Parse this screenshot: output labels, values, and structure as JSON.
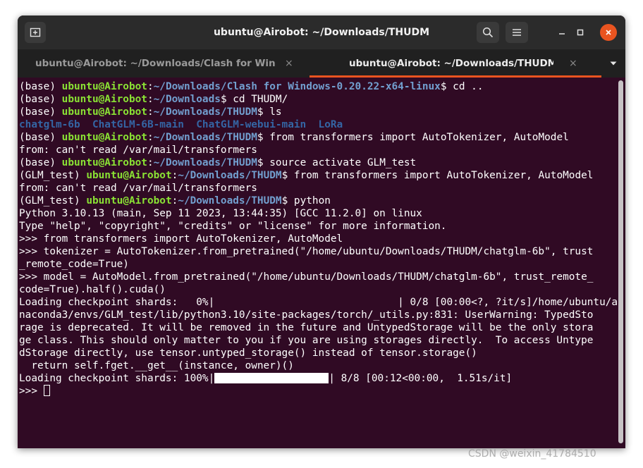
{
  "window": {
    "title": "ubuntu@Airobot: ~/Downloads/THUDM"
  },
  "tabs": [
    {
      "label": "ubuntu@Airobot: ~/Downloads/Clash for Win...",
      "active": false
    },
    {
      "label": "ubuntu@Airobot: ~/Downloads/THUDM",
      "active": true
    }
  ],
  "icons": {
    "new_tab": "new-tab-icon",
    "search": "search-icon",
    "menu": "hamburger-menu-icon",
    "minimize": "minimize-icon",
    "maximize": "maximize-icon",
    "close": "close-icon",
    "tab_close": "×",
    "tabs_dropdown": "chevron-down-icon"
  },
  "colors": {
    "terminal_bg": "#300a24",
    "user_host": "#8ae234",
    "path": "#729fcf",
    "directory": "#3465a4",
    "accent": "#e95420"
  },
  "terminal": {
    "lines": [
      {
        "type": "prompt",
        "env": "(base) ",
        "user": "ubuntu@Airobot",
        "path": "~/Downloads/Clash for Windows-0.20.22-x64-linux",
        "cmd": " cd .."
      },
      {
        "type": "prompt",
        "env": "(base) ",
        "user": "ubuntu@Airobot",
        "path": "~/Downloads",
        "cmd": " cd THUDM/"
      },
      {
        "type": "prompt",
        "env": "(base) ",
        "user": "ubuntu@Airobot",
        "path": "~/Downloads/THUDM",
        "cmd": " ls"
      },
      {
        "type": "dirs",
        "text": "chatglm-6b  ChatGLM-6B-main  ChatGLM-webui-main  LoRa"
      },
      {
        "type": "prompt",
        "env": "(base) ",
        "user": "ubuntu@Airobot",
        "path": "~/Downloads/THUDM",
        "cmd": " from transformers import AutoTokenizer, AutoModel"
      },
      {
        "type": "text",
        "text": "from: can't read /var/mail/transformers"
      },
      {
        "type": "prompt",
        "env": "(base) ",
        "user": "ubuntu@Airobot",
        "path": "~/Downloads/THUDM",
        "cmd": " source activate GLM_test"
      },
      {
        "type": "prompt",
        "env": "(GLM_test) ",
        "user": "ubuntu@Airobot",
        "path": "~/Downloads/THUDM",
        "cmd": " from transformers import AutoTokenizer, AutoModel"
      },
      {
        "type": "text",
        "text": "from: can't read /var/mail/transformers"
      },
      {
        "type": "prompt",
        "env": "(GLM_test) ",
        "user": "ubuntu@Airobot",
        "path": "~/Downloads/THUDM",
        "cmd": " python"
      },
      {
        "type": "text",
        "text": "Python 3.10.13 (main, Sep 11 2023, 13:44:35) [GCC 11.2.0] on linux"
      },
      {
        "type": "text",
        "text": "Type \"help\", \"copyright\", \"credits\" or \"license\" for more information."
      },
      {
        "type": "text",
        "text": ">>> from transformers import AutoTokenizer, AutoModel"
      },
      {
        "type": "text",
        "text": ">>> tokenizer = AutoTokenizer.from_pretrained(\"/home/ubuntu/Downloads/THUDM/chatglm-6b\", trust"
      },
      {
        "type": "text",
        "text": "_remote_code=True)"
      },
      {
        "type": "text",
        "text": ">>> model = AutoModel.from_pretrained(\"/home/ubuntu/Downloads/THUDM/chatglm-6b\", trust_remote_"
      },
      {
        "type": "text",
        "text": "code=True).half().cuda()"
      },
      {
        "type": "text",
        "text": "Loading checkpoint shards:   0%|                              | 0/8 [00:00<?, ?it/s]/home/ubuntu/a"
      },
      {
        "type": "text",
        "text": "naconda3/envs/GLM_test/lib/python3.10/site-packages/torch/_utils.py:831: UserWarning: TypedSto"
      },
      {
        "type": "text",
        "text": "rage is deprecated. It will be removed in the future and UntypedStorage will be the only stora"
      },
      {
        "type": "text",
        "text": "ge class. This should only matter to you if you are using storages directly.  To access Untype"
      },
      {
        "type": "text",
        "text": "dStorage directly, use tensor.untyped_storage() instead of tensor.storage()"
      },
      {
        "type": "text",
        "text": "  return self.fget.__get__(instance, owner)()"
      },
      {
        "type": "progress",
        "pre": "Loading checkpoint shards: 100%|",
        "progress": 1.0,
        "post": "| 8/8 [00:12<00:00,  1.51s/it]"
      },
      {
        "type": "input",
        "text": ">>> "
      }
    ],
    "prompt_sep": ":",
    "prompt_end": "$"
  },
  "watermark": "CSDN @weixin_41784510"
}
